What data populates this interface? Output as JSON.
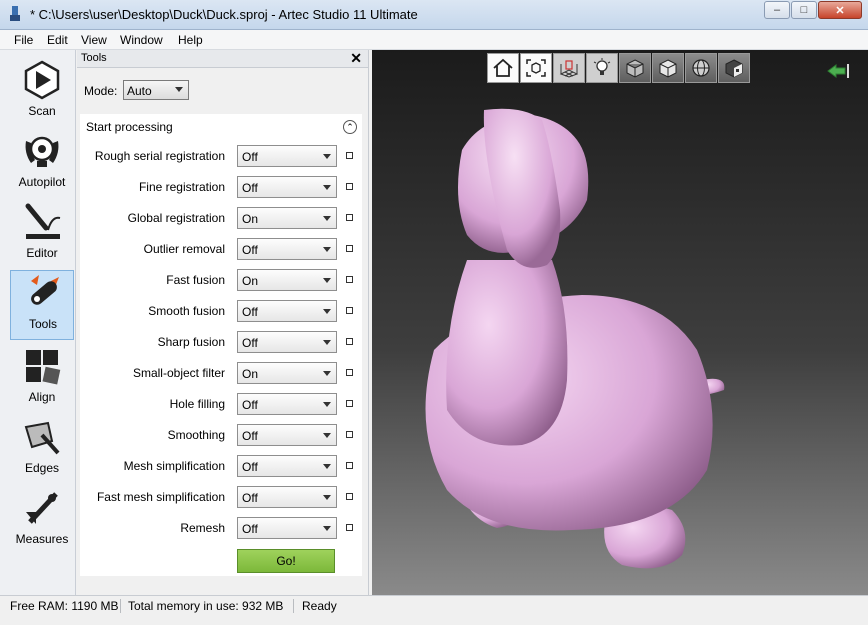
{
  "window": {
    "title": "* C:\\Users\\user\\Desktop\\Duck\\Duck.sproj - Artec Studio 11 Ultimate",
    "minimize": "–",
    "maximize": "□",
    "close": "✕"
  },
  "menu": [
    "File",
    "Edit",
    "View",
    "Window",
    "Help"
  ],
  "leftbar": {
    "items": [
      {
        "label": "Scan",
        "icon": "scan-icon"
      },
      {
        "label": "Autopilot",
        "icon": "autopilot-icon"
      },
      {
        "label": "Editor",
        "icon": "editor-icon"
      },
      {
        "label": "Tools",
        "icon": "tools-icon",
        "active": true
      },
      {
        "label": "Align",
        "icon": "align-icon"
      },
      {
        "label": "Edges",
        "icon": "edges-icon"
      },
      {
        "label": "Measures",
        "icon": "measures-icon"
      }
    ]
  },
  "panel": {
    "title": "Tools",
    "close": "✕",
    "mode_label": "Mode:",
    "mode_value": "Auto",
    "section_title": "Start processing",
    "collapse": "⌃",
    "rows": [
      {
        "label": "Rough serial registration",
        "value": "Off"
      },
      {
        "label": "Fine registration",
        "value": "Off"
      },
      {
        "label": "Global registration",
        "value": "On"
      },
      {
        "label": "Outlier removal",
        "value": "Off"
      },
      {
        "label": "Fast fusion",
        "value": "On"
      },
      {
        "label": "Smooth fusion",
        "value": "Off"
      },
      {
        "label": "Sharp fusion",
        "value": "Off"
      },
      {
        "label": "Small-object filter",
        "value": "On"
      },
      {
        "label": "Hole filling",
        "value": "Off"
      },
      {
        "label": "Smoothing",
        "value": "Off"
      },
      {
        "label": "Mesh simplification",
        "value": "Off"
      },
      {
        "label": "Fast mesh simplification",
        "value": "Off"
      },
      {
        "label": "Remesh",
        "value": "Off"
      }
    ],
    "go_label": "Go!"
  },
  "viewport": {
    "toolbar": [
      "home-view-icon",
      "fit-view-icon",
      "grid-icon",
      "light-icon",
      "shaded-cube-icon",
      "solid-cube-icon",
      "sphere-icon",
      "texture-cube-icon"
    ],
    "model_color": "#d9a6d6",
    "back_icon": "back-arrow-icon"
  },
  "status": {
    "free_ram": "Free RAM: 1190 MB",
    "total_memory": "Total memory in use: 932 MB",
    "state": "Ready"
  }
}
